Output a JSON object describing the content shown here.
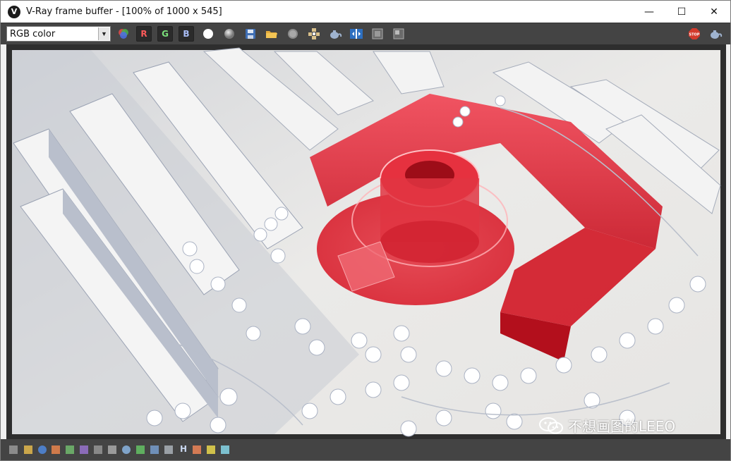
{
  "window": {
    "title": "V-Ray frame buffer - [100% of 1000 x 545]",
    "app_icon": "vray-logo-icon",
    "controls": {
      "minimize": "—",
      "maximize": "☐",
      "close": "✕"
    }
  },
  "toolbar": {
    "channel_value": "RGB color",
    "r_label": "R",
    "g_label": "G",
    "b_label": "B",
    "r_color": "#ff5a5a",
    "g_color": "#7be07b",
    "b_color": "#a9bdf5",
    "icons": [
      "color-wheel-icon",
      "white-circle-icon",
      "gray-circle-icon",
      "save-icon",
      "open-folder-icon",
      "clear-icon",
      "track-mouse-icon",
      "teapot-render-icon",
      "compare-icon",
      "region-render-icon",
      "history-icon",
      "stop-icon",
      "teapot-icon"
    ]
  },
  "render": {
    "description_colors": {
      "ground": "#e9e8e6",
      "building": "#ea1726",
      "shadow": "#8a95ac"
    }
  },
  "watermark": {
    "text": "不想画图的LEEO",
    "icon": "wechat-icon"
  },
  "statusbar": {
    "icons": [
      "frame-icon",
      "lut-icon",
      "info-icon",
      "color-correct-icon",
      "levels-icon",
      "curves-icon",
      "histogram-icon",
      "lens-effects-icon",
      "stamp-icon",
      "background-icon",
      "graph-icon",
      "sRGB-icon",
      "h-icon",
      "exposure-icon",
      "test-icon",
      "settings-icon"
    ],
    "h_label": "H"
  }
}
